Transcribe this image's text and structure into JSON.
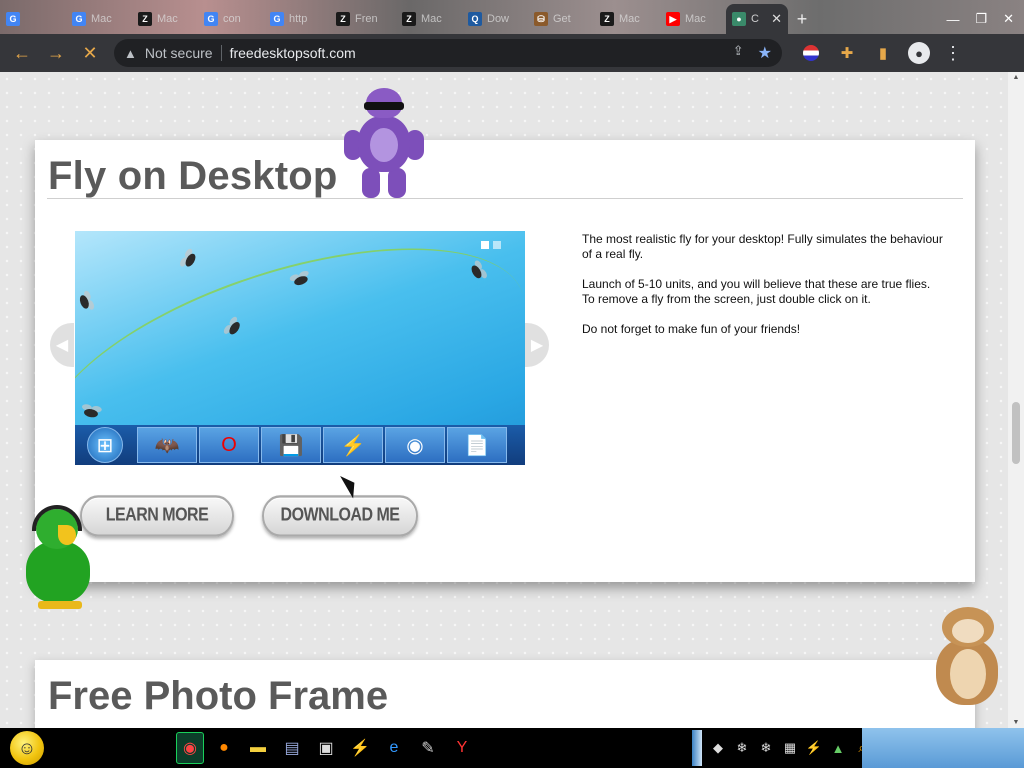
{
  "browser": {
    "tabs": [
      {
        "label": "",
        "favicon": "G",
        "color": "#4285f4"
      },
      {
        "label": "Mac",
        "favicon": "G",
        "color": "#4285f4"
      },
      {
        "label": "Mac",
        "favicon": "Z",
        "color": "#1a1a1a"
      },
      {
        "label": "con",
        "favicon": "G",
        "color": "#4285f4"
      },
      {
        "label": "http",
        "favicon": "G",
        "color": "#4285f4"
      },
      {
        "label": "Fren",
        "favicon": "Z",
        "color": "#1a1a1a"
      },
      {
        "label": "Mac",
        "favicon": "Z",
        "color": "#1a1a1a"
      },
      {
        "label": "Dow",
        "favicon": "Q",
        "color": "#1e5aa0"
      },
      {
        "label": "Get",
        "favicon": "⛁",
        "color": "#8b5a2b"
      },
      {
        "label": "Mac",
        "favicon": "Z",
        "color": "#1a1a1a"
      },
      {
        "label": "Mac",
        "favicon": "▶",
        "color": "#ff0000"
      },
      {
        "label": "C",
        "favicon": "●",
        "color": "#3a8a6a"
      }
    ],
    "new_tab": "+",
    "close_tab": "✕",
    "security_label": "Not secure",
    "url": "freedesktopsoft.com"
  },
  "page": {
    "product_title": "Fly on Desktop",
    "description": [
      "The most realistic fly for your desktop! Fully simulates the behaviour of a real fly.",
      "Launch of 5-10 units, and you will believe that these are true flies.",
      "To remove a fly from the screen, just double click on it.",
      "Do not forget to make fun of your friends!"
    ],
    "learn_more": "LEARN MORE",
    "download": "DOWNLOAD ME",
    "next_title": "Free Photo Frame",
    "slider_pages": 2,
    "slider_current": 1
  },
  "icons": {
    "back": "back-arrow-icon",
    "forward": "forward-arrow-icon",
    "stop": "stop-icon",
    "warning": "warning-icon",
    "share": "share-icon",
    "bookmark": "star-icon",
    "extensions": "puzzle-icon",
    "sidepanel": "sidepanel-icon",
    "profile": "profile-icon",
    "menu": "kebab-menu-icon"
  },
  "colors": {
    "chrome_toolbar": "#35363a",
    "omnibox": "#202124",
    "nav_icon": "#e6a84a",
    "bookmark_star": "#8ab4f8",
    "title_text": "#5a5a5a"
  }
}
